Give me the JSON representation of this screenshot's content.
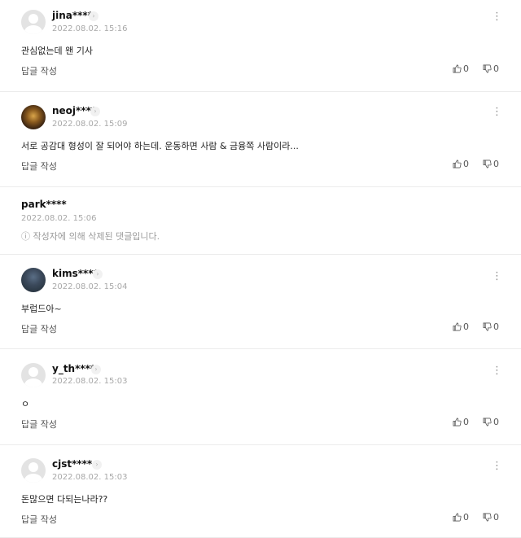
{
  "icons": {
    "chevron": "›",
    "more": "⋮"
  },
  "reply_label": "답글 작성",
  "comments": [
    {
      "user": "jina****",
      "time": "2022.08.02. 15:16",
      "text": "관심없는데 왠 기사",
      "likes": "0",
      "dislikes": "0",
      "avatar": "default-avatar-icon"
    },
    {
      "user": "neoj****",
      "time": "2022.08.02. 15:09",
      "text": "서로 공감대 형성이 잘 되어야 하는데. 운동하면 사람 & 금융쪽 사람이라...",
      "likes": "0",
      "dislikes": "0",
      "avatar": "profile-photo"
    },
    {
      "user": "park****",
      "time": "2022.08.02. 15:06",
      "text": "작성자에 의해 삭제된 댓글입니다.",
      "deleted_icon": "ⓘ"
    },
    {
      "user": "kims****",
      "time": "2022.08.02. 15:04",
      "text": "부럽드아~",
      "likes": "0",
      "dislikes": "0",
      "avatar": "profile-photo"
    },
    {
      "user": "y_th****",
      "time": "2022.08.02. 15:03",
      "text": "ㅇ",
      "likes": "0",
      "dislikes": "0",
      "avatar": "default-avatar-icon"
    },
    {
      "user": "cjst****",
      "time": "2022.08.02. 15:03",
      "text": "돈많으면 다되는나라??",
      "likes": "0",
      "dislikes": "0",
      "avatar": "default-avatar-icon"
    }
  ]
}
